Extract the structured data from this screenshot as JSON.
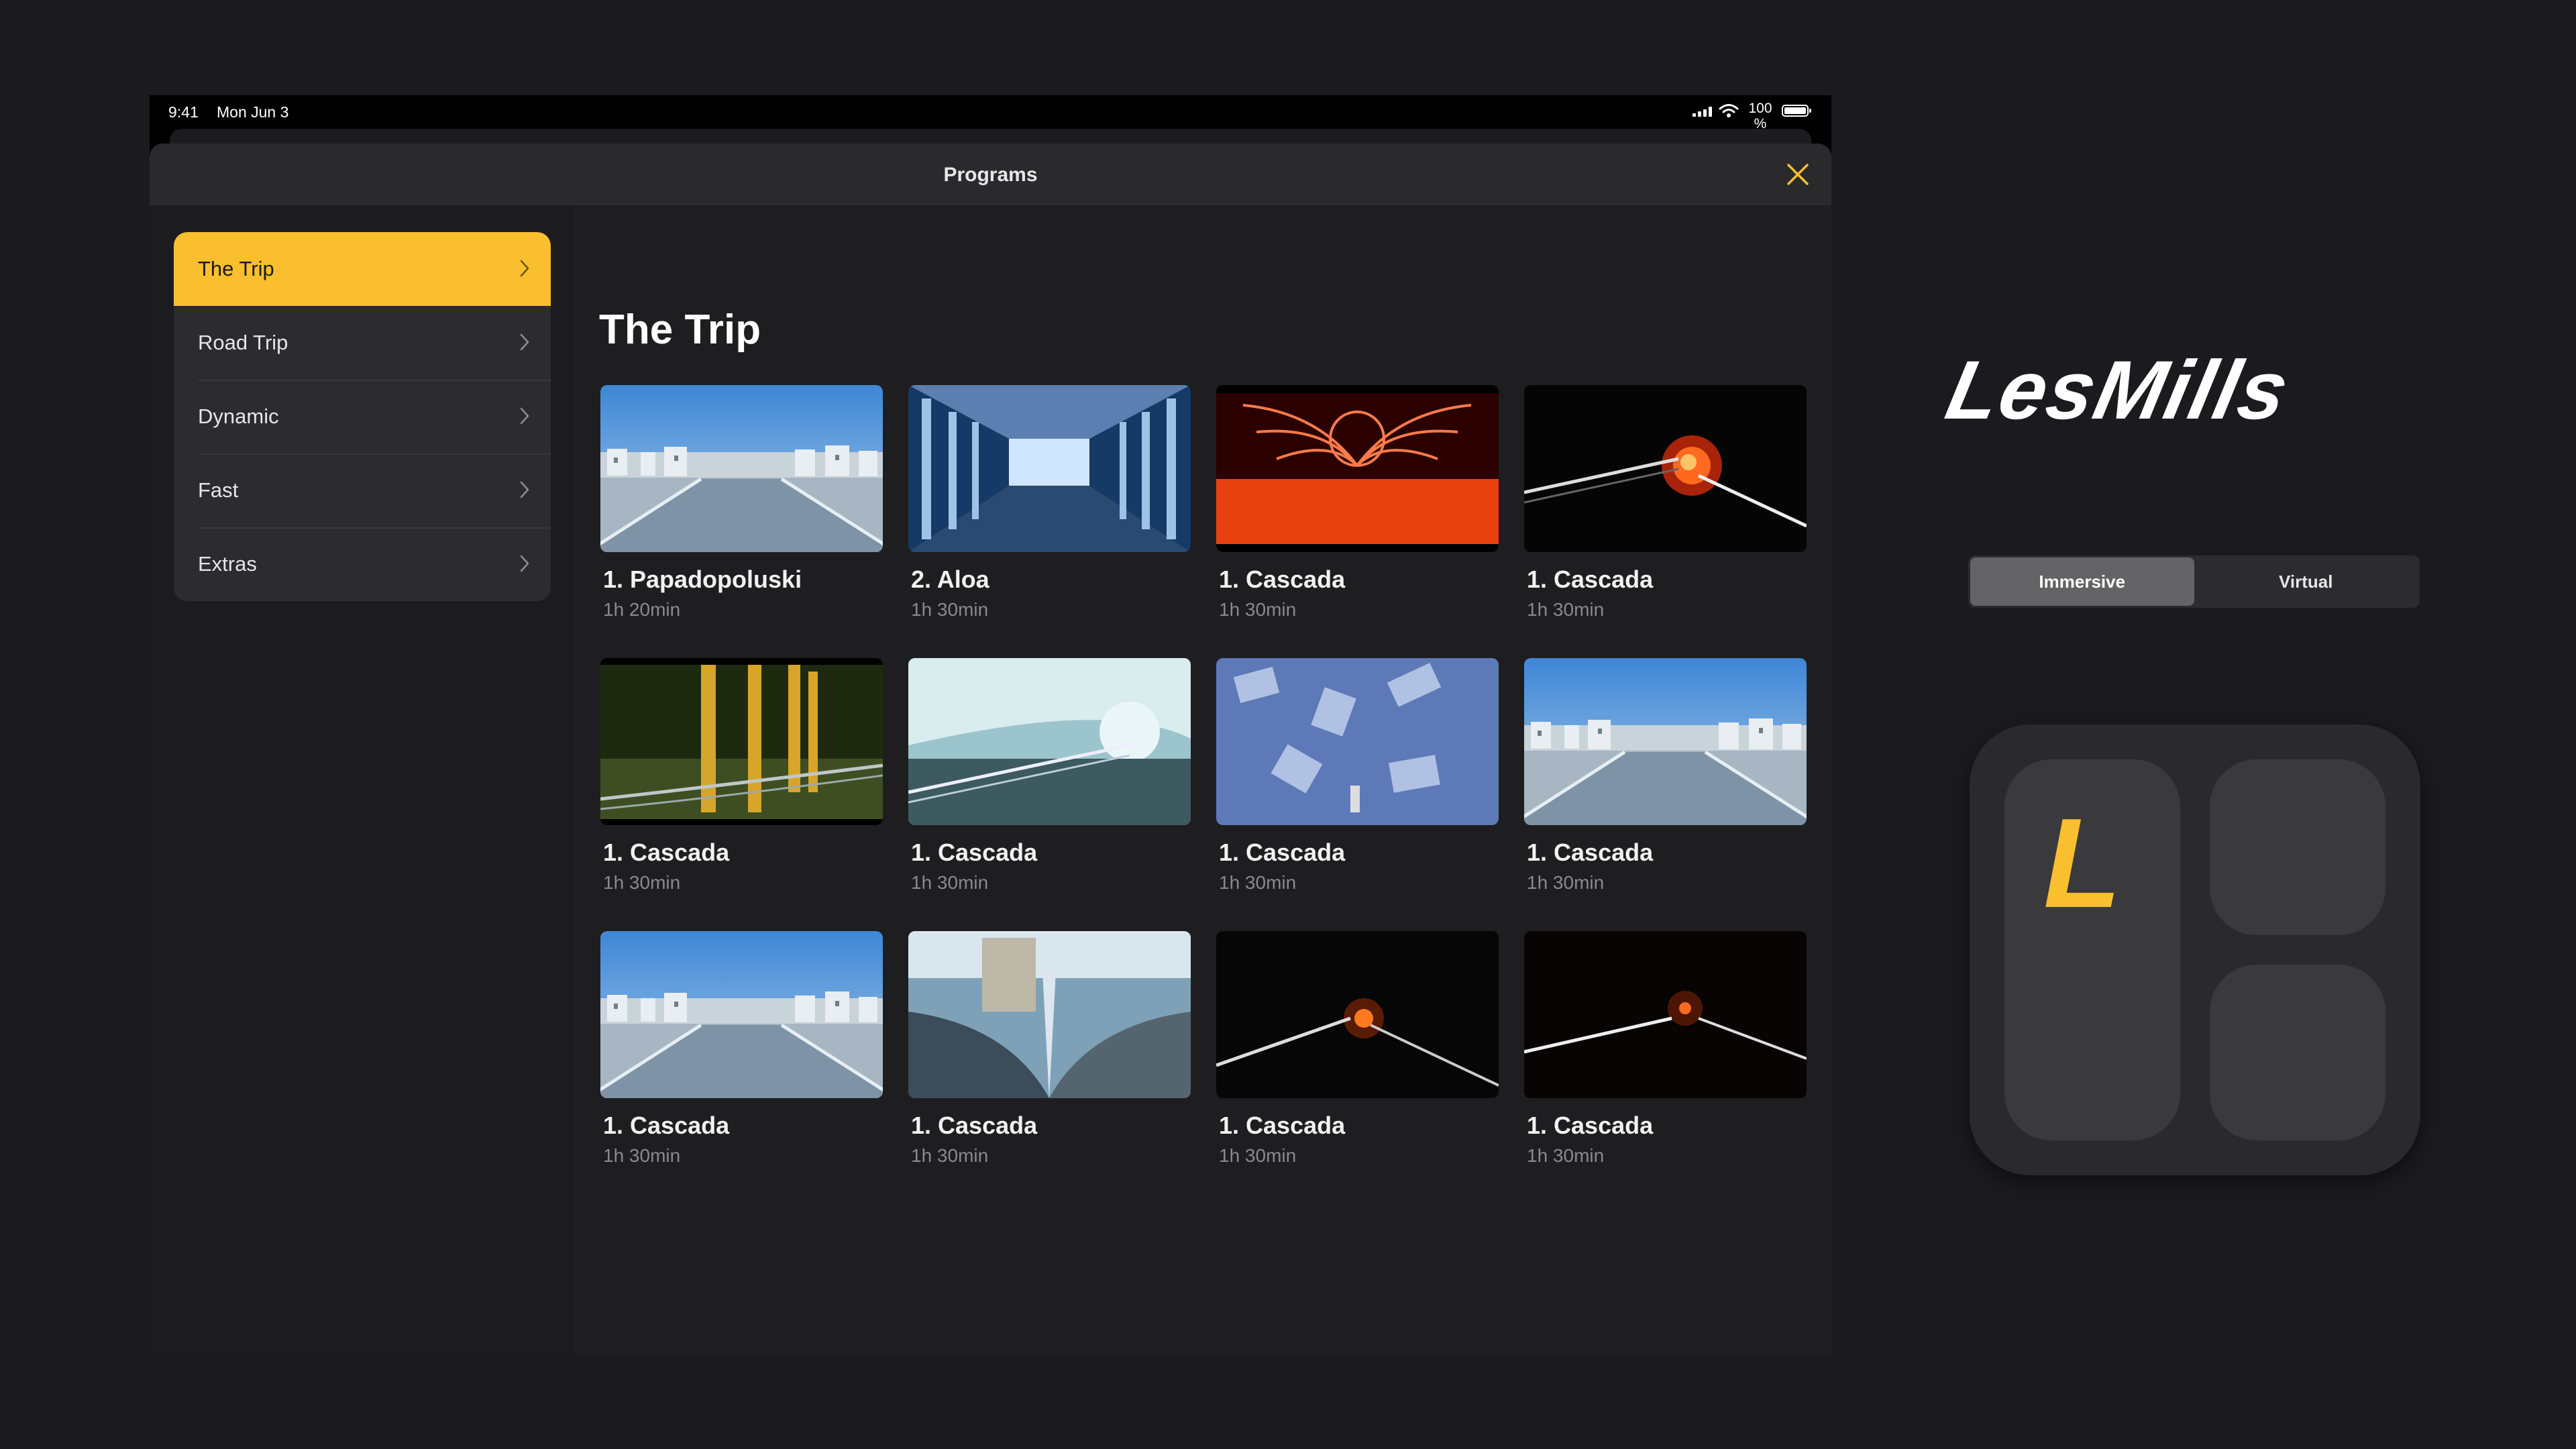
{
  "statusbar": {
    "time": "9:41",
    "date": "Mon Jun 3",
    "battery": "100\n%",
    "battery_level": 1.0
  },
  "sheet": {
    "title": "Programs"
  },
  "sidebar": {
    "items": [
      {
        "label": "The Trip",
        "active": true
      },
      {
        "label": "Road Trip",
        "active": false
      },
      {
        "label": "Dynamic",
        "active": false
      },
      {
        "label": "Fast",
        "active": false
      },
      {
        "label": "Extras",
        "active": false
      }
    ]
  },
  "main": {
    "section_title": "The Trip",
    "cards": [
      {
        "title": "1. Papadopoluski",
        "duration": "1h 20min",
        "scene": "town"
      },
      {
        "title": "2. Aloa",
        "duration": "1h 30min",
        "scene": "corridor"
      },
      {
        "title": "1. Cascada",
        "duration": "1h 30min",
        "scene": "neon"
      },
      {
        "title": "1. Cascada",
        "duration": "1h 30min",
        "scene": "fire"
      },
      {
        "title": "1. Cascada",
        "duration": "1h 30min",
        "scene": "bamboo"
      },
      {
        "title": "1. Cascada",
        "duration": "1h 30min",
        "scene": "ice"
      },
      {
        "title": "1. Cascada",
        "duration": "1h 30min",
        "scene": "blocks"
      },
      {
        "title": "1. Cascada",
        "duration": "1h 30min",
        "scene": "town"
      },
      {
        "title": "1. Cascada",
        "duration": "1h 30min",
        "scene": "town"
      },
      {
        "title": "1. Cascada",
        "duration": "1h 30min",
        "scene": "glacier"
      },
      {
        "title": "1. Cascada",
        "duration": "1h 30min",
        "scene": "dark"
      },
      {
        "title": "1. Cascada",
        "duration": "1h 30min",
        "scene": "dark2"
      }
    ]
  },
  "brand": {
    "logo_text": "LesMills",
    "segments": [
      {
        "label": "Immersive",
        "active": true
      },
      {
        "label": "Virtual",
        "active": false
      }
    ],
    "icon_letter": "L",
    "accent": "#f9bf2e"
  }
}
